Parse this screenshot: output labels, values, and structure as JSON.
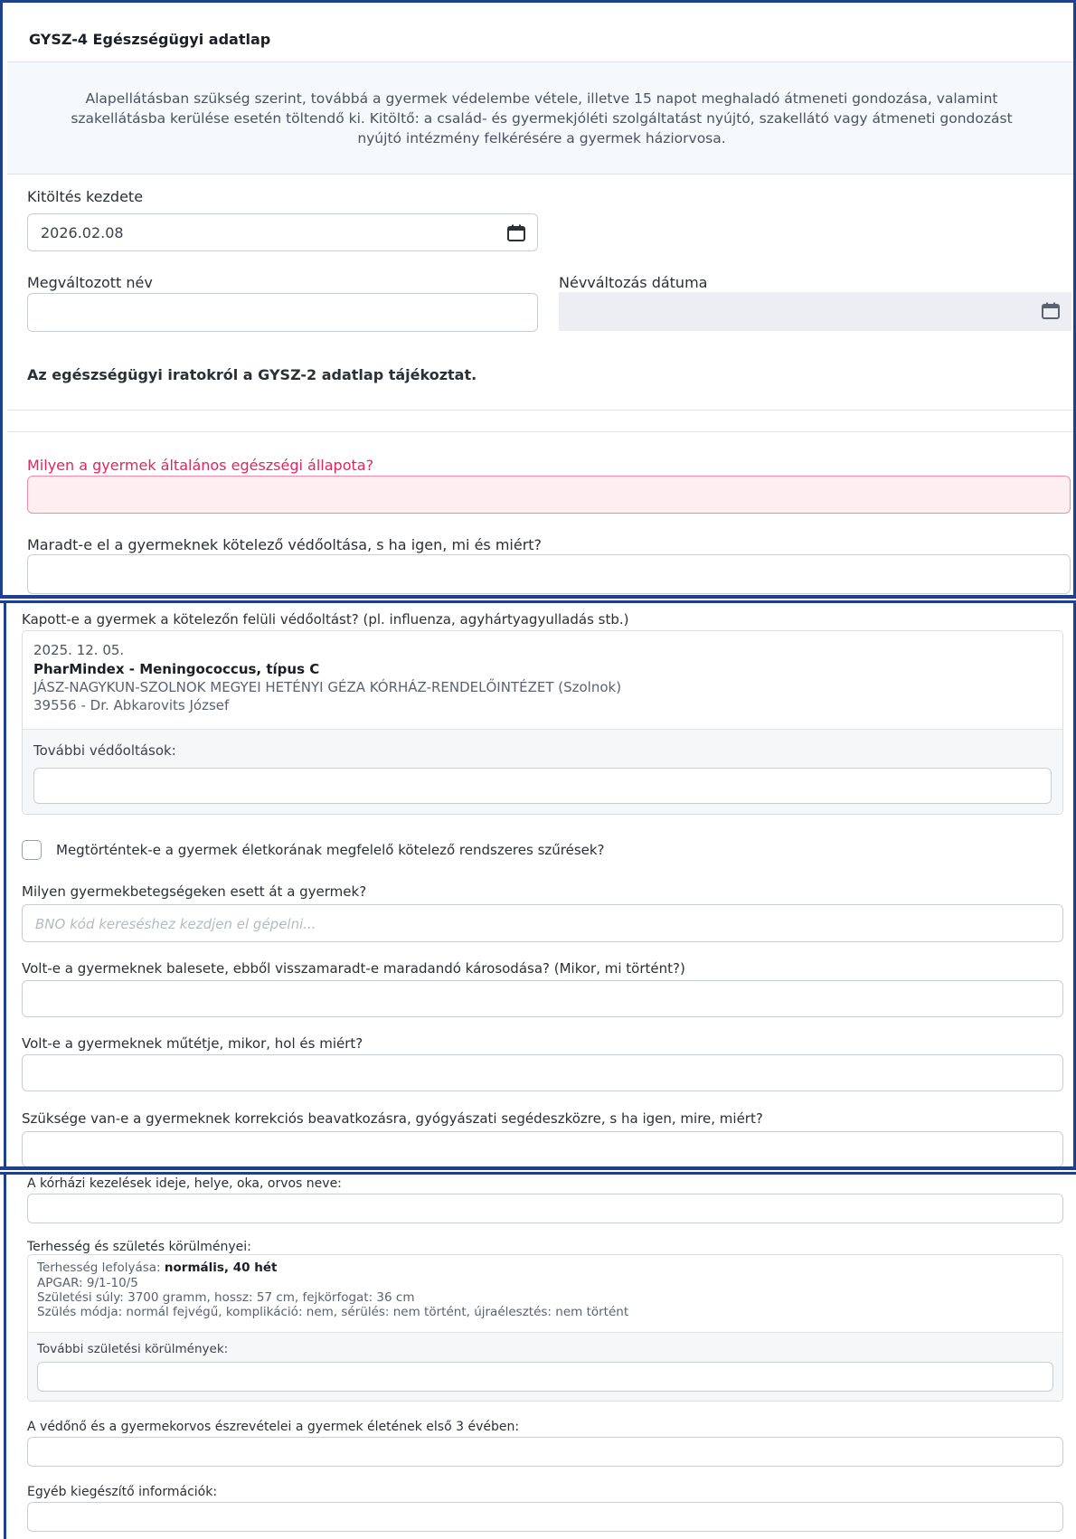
{
  "header": {
    "title": "GYSZ-4 Egészségügyi adatlap",
    "intro": "Alapellátásban szükség szerint, továbbá a gyermek védelembe vétele, illetve 15 napot meghaladó átmeneti gondozása, valamint szakellátásba kerülése esetén töltendő ki. Kitöltő: a család- és gyermekjóléti szolgáltatást nyújtó, szakellátó vagy átmeneti gondozást nyújtó intézmény felkérésére a gyermek háziorvosa."
  },
  "start": {
    "label": "Kitöltés kezdete",
    "value": "2026.02.08"
  },
  "changed_name": {
    "label": "Megváltozott név",
    "value": ""
  },
  "name_change_date": {
    "label": "Névváltozás dátuma",
    "value": ""
  },
  "records_note": "Az egészségügyi iratokról a GYSZ-2 adatlap tájékoztat.",
  "health_state": {
    "label": "Milyen a gyermek általános egészségi állapota?",
    "value": ""
  },
  "missed_vaccines": {
    "label": "Maradt-e el a gyermeknek kötelező védőoltása, s ha igen, mi és miért?",
    "value": ""
  },
  "extra_vaccines": {
    "label": "Kapott-e a gyermek a kötelezőn felüli védőoltást? (pl. influenza, agyhártyagyulladás stb.)",
    "date": "2025. 12. 05.",
    "vaccine": "PharMindex - Meningococcus, típus C",
    "institution": "JÁSZ-NAGYKUN-SZOLNOK MEGYEI HETÉNYI GÉZA KÓRHÁZ-RENDELŐINTÉZET (Szolnok)",
    "doctor": "39556 - Dr. Abkarovits József",
    "more_label": "További védőoltások:",
    "more_value": ""
  },
  "screenings": {
    "label": "Megtörténtek-e a gyermek életkorának megfelelő kötelező rendszeres szűrések?",
    "checked": false
  },
  "diseases": {
    "label": "Milyen gyermekbetegségeken esett át a gyermek?",
    "placeholder": "BNO kód kereséshez kezdjen el gépelni..."
  },
  "accident": {
    "label": "Volt-e a gyermeknek balesete, ebből visszamaradt-e maradandó károsodása? (Mikor, mi történt?)",
    "value": ""
  },
  "surgery": {
    "label": "Volt-e a gyermeknek műtétje, mikor, hol és miért?",
    "value": ""
  },
  "correction": {
    "label": "Szüksége van-e a gyermeknek korrekciós beavatkozásra, gyógyászati segédeszközre, s ha igen, mire, miért?",
    "value": ""
  },
  "hospital": {
    "label": "A kórházi kezelések ideje, helye, oka, orvos neve:",
    "value": ""
  },
  "pregnancy": {
    "label": "Terhesség és születés körülményei:",
    "course_prefix": "Terhesség lefolyása: ",
    "course_value": "normális, 40 hét",
    "apgar": "APGAR: 9/1-10/5",
    "birth_data": "Születési súly: 3700 gramm, hossz: 57 cm, fejkörfogat: 36 cm",
    "birth_mode": "Szülés módja: normál fejvégű, komplikáció: nem, sérülés: nem történt, újraélesztés: nem történt",
    "more_label": "További születési körülmények:",
    "more_value": ""
  },
  "nurse_notes": {
    "label": "A védőnő és a gyermekorvos észrevételei a gyermek életének első 3 évében:",
    "value": ""
  },
  "other_info": {
    "label": "Egyéb kiegészítő információk:",
    "value": ""
  }
}
